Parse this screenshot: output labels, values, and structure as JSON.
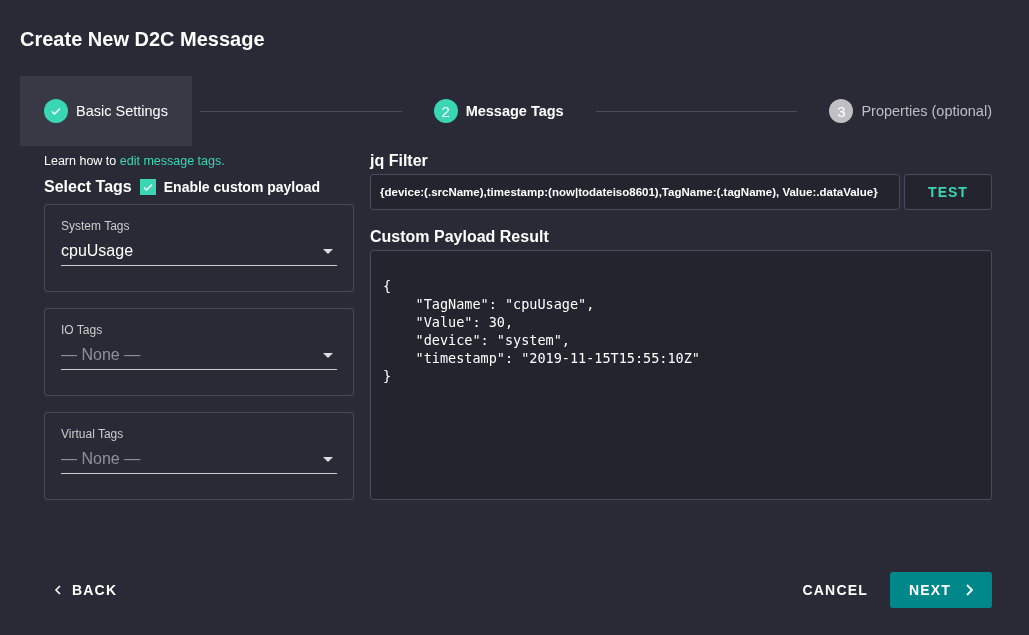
{
  "title": "Create New D2C Message",
  "steps": [
    {
      "label": "Basic Settings",
      "completed": true,
      "selected": false,
      "highlighted": true
    },
    {
      "label": "Message Tags",
      "completed": false,
      "selected": true,
      "number": "2",
      "highlighted": false
    },
    {
      "label": "Properties (optional)",
      "completed": false,
      "selected": false,
      "number": "3",
      "highlighted": false
    }
  ],
  "help": {
    "prefix": "Learn how to",
    "link": "edit message tags."
  },
  "select_tags": {
    "heading": "Select Tags",
    "checkbox_label": "Enable custom payload",
    "checked": true
  },
  "tag_selects": [
    {
      "label": "System Tags",
      "value": "cpuUsage"
    },
    {
      "label": "IO Tags",
      "placeholder": "— None —"
    },
    {
      "label": "Virtual Tags",
      "placeholder": "— None —"
    }
  ],
  "jq_filter": {
    "label": "jq Filter",
    "value": "{device:(.srcName),timestamp:(now|todateiso8601),TagName:(.tagName), Value:.dataValue}",
    "button": "TEST"
  },
  "result": {
    "label": "Custom Payload Result",
    "lines": [
      "{",
      "    \"TagName\": \"cpuUsage\",",
      "    \"Value\": 30,",
      "    \"device\": \"system\",",
      "    \"timestamp\": \"2019-11-15T15:55:10Z\"",
      "}"
    ]
  },
  "footer": {
    "back": "BACK",
    "cancel": "CANCEL",
    "next": "NEXT"
  }
}
